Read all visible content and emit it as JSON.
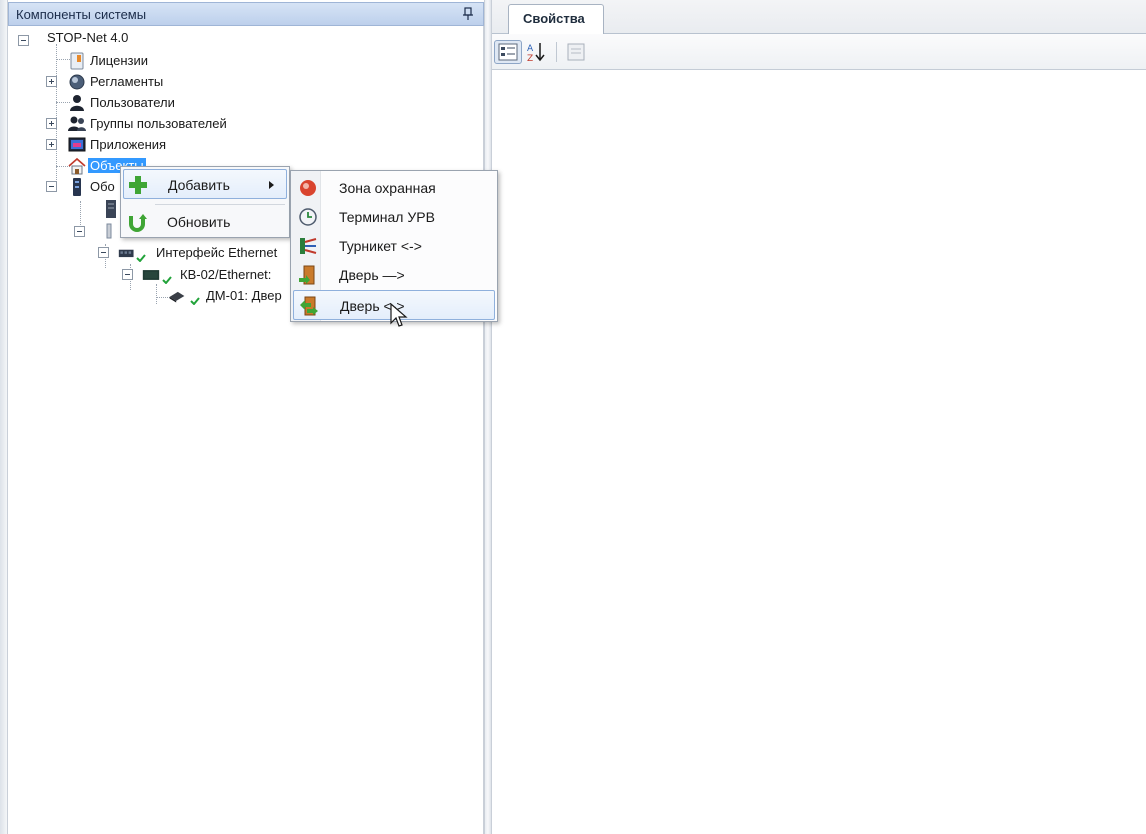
{
  "left_panel": {
    "title": "Компоненты системы"
  },
  "tree": {
    "root": "STOP-Net 4.0",
    "items": [
      {
        "label": "Лицензии"
      },
      {
        "label": "Регламенты"
      },
      {
        "label": "Пользователи"
      },
      {
        "label": "Группы пользователей"
      },
      {
        "label": "Приложения"
      },
      {
        "label": "Объекты"
      },
      {
        "label": "Обо"
      },
      {
        "label": "Интерфейс Ethernet"
      },
      {
        "label": "КВ-02/Ethernet:"
      },
      {
        "label": "ДМ-01: Двер"
      }
    ]
  },
  "context_menu": {
    "add": "Добавить",
    "refresh": "Обновить"
  },
  "submenu": {
    "items": [
      {
        "label": "Зона охранная"
      },
      {
        "label": "Терминал УРВ"
      },
      {
        "label": "Турникет <->"
      },
      {
        "label": "Дверь —>"
      },
      {
        "label": "Дверь <->"
      }
    ]
  },
  "right_panel": {
    "tab": "Свойства"
  },
  "colors": {
    "header_bg": "#bdd0ec",
    "selection": "#3399ff",
    "menu_hover_border": "#8fb0dc"
  }
}
